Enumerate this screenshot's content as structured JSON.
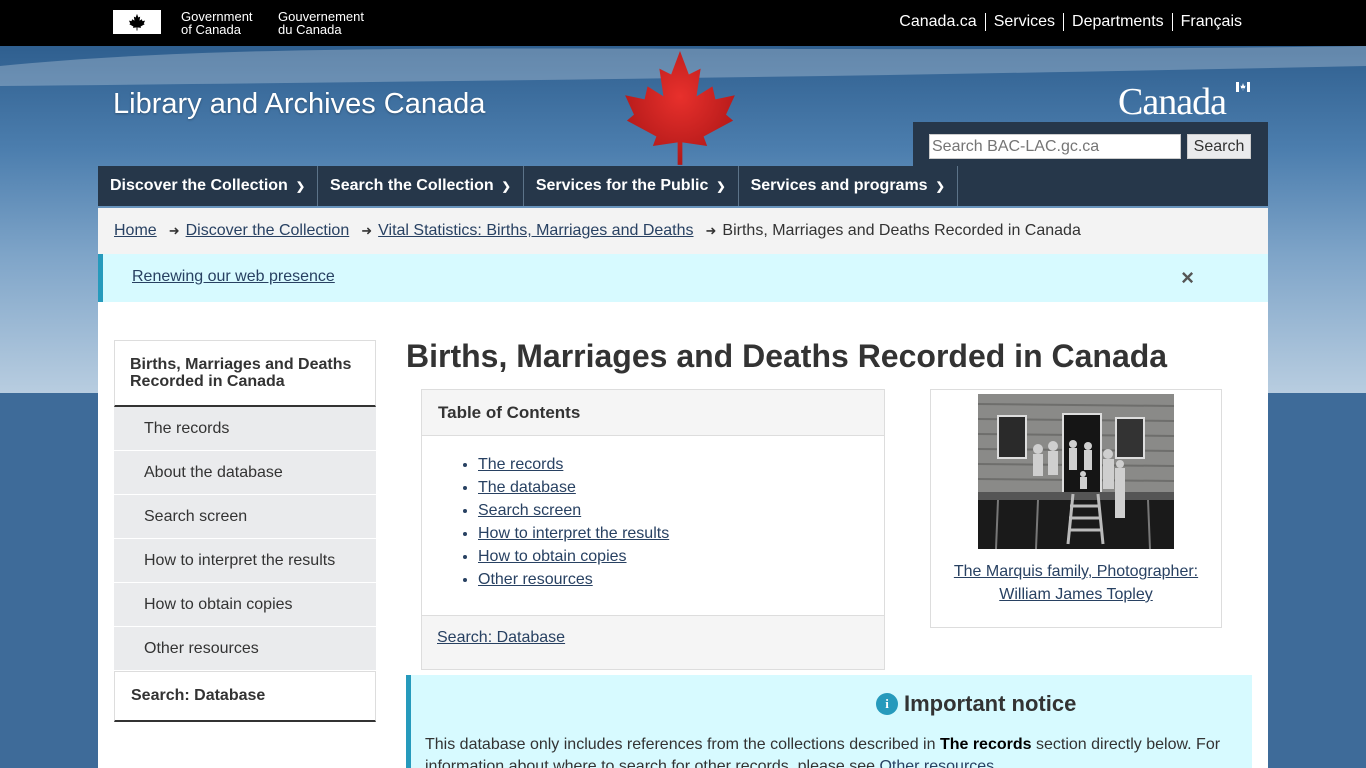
{
  "gov": {
    "en_line1": "Government",
    "en_line2": "of Canada",
    "fr_line1": "Gouvernement",
    "fr_line2": "du Canada"
  },
  "toplinks": [
    "Canada.ca",
    "Services",
    "Departments",
    "Français"
  ],
  "site_title": "Library and Archives Canada",
  "wordmark": "Canada",
  "search": {
    "placeholder": "Search BAC-LAC.gc.ca",
    "button": "Search"
  },
  "nav": [
    {
      "label": "Discover the Collection"
    },
    {
      "label": "Search the Collection"
    },
    {
      "label": "Services for the Public"
    },
    {
      "label": "Services and programs"
    }
  ],
  "breadcrumb": {
    "links": [
      "Home",
      "Discover the Collection",
      "Vital Statistics: Births, Marriages and Deaths"
    ],
    "current": "Births, Marriages and Deaths Recorded in Canada"
  },
  "notice": {
    "link": "Renewing our web presence",
    "close": "×"
  },
  "secnav": {
    "head": "Births, Marriages and Deaths Recorded in Canada",
    "items": [
      "The records",
      "About the database",
      "Search screen",
      "How to interpret the results",
      "How to obtain copies",
      "Other resources"
    ],
    "foot": "Search: Database"
  },
  "page_title": "Births, Marriages and Deaths Recorded in Canada",
  "toc": {
    "title": "Table of Contents",
    "items": [
      "The records",
      "The database",
      "Search screen",
      "How to interpret the results",
      "How to obtain copies",
      "Other resources"
    ],
    "footer_link": "Search: Database"
  },
  "figure": {
    "caption": "The Marquis family, Photographer: William James Topley"
  },
  "important": {
    "title": "Important notice",
    "text_before": "This database only includes references from the collections described in ",
    "text_bold": "The records",
    "text_after": " section directly below. For information about where to search for other records, please see ",
    "text_link": "Other resources"
  },
  "colors": {
    "nav_bg": "#26374a",
    "link": "#284162",
    "notice_bg": "#d7faff",
    "notice_border": "#269abc"
  }
}
